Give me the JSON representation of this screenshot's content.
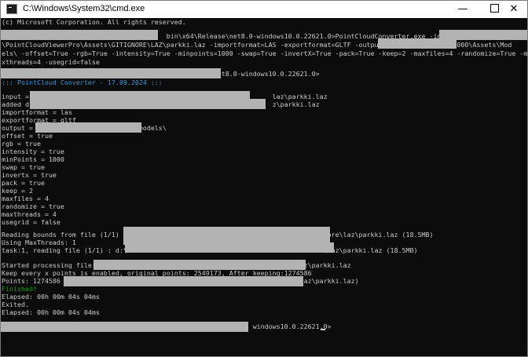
{
  "window": {
    "title": "C:\\Windows\\System32\\cmd.exe",
    "minimize_label": "—",
    "close_label": "✕"
  },
  "console": {
    "lines": [
      "(c) Microsoft Corporation. All rights reserved.",
      "",
      "                                          bin\\x64\\Release\\net8.0-windows10.0.22621.0>PointCloudConverter.exe -input=",
      "\\PointCloudViewerPro\\Assets\\GITIGNORE\\LAZ\\parkki.laz -importformat=LAS -exportformat=GLTF -output=                C6000\\Assets\\Mod",
      "els\\ -offset=True -rgb=True -intensity=True -minpoints=1000 -swap=True -invertX=True -pack=True -keep=2 -maxfiles=4 -randomize=True -ma",
      "xthreads=4 -usegrid=false",
      "",
      "                                                       et8.0-windows10.0.22621.0>",
      "::: PointCloud Converter - 17.09.2024 :::",
      "",
      "input =                                                              laz\\parkki.laz",
      "added d:                                                             z\\parkki.laz",
      "importformat = las",
      "exportformat = gltf",
      "output =                     ssets\\models\\",
      "offset = true",
      "rgb = true",
      "intensity = true",
      "minPoints = 1000",
      "swap = true",
      "invertx = true",
      "pack = true",
      "keep = 2",
      "maxfiles = 4",
      "randomize = true",
      "maxthreads = 4",
      "usegrid = false",
      "",
      "Reading bounds from file (1/1) :                                                  nore\\laz\\parkki.laz (18.5MB)",
      "Using MaxThreads: 1",
      "task:1, reading file (1/1) : d:\\                                                  \\laz\\parkki.laz (18.5MB)",
      "",
      "Started processing file:                                                  \\laz\\parkki.laz",
      "Keep every x points is enabled, original points: 2549173, After keeping:1274586",
      "Points: 1274586 (                                                          \\laz\\parkki.laz)",
      "Finished!",
      "Elapsed: 00h 00m 04s 04ms",
      "Exited.",
      "Elapsed: 00h 00m 04s 04ms",
      "",
      "                                                                windows10.0.22621.0>"
    ]
  }
}
